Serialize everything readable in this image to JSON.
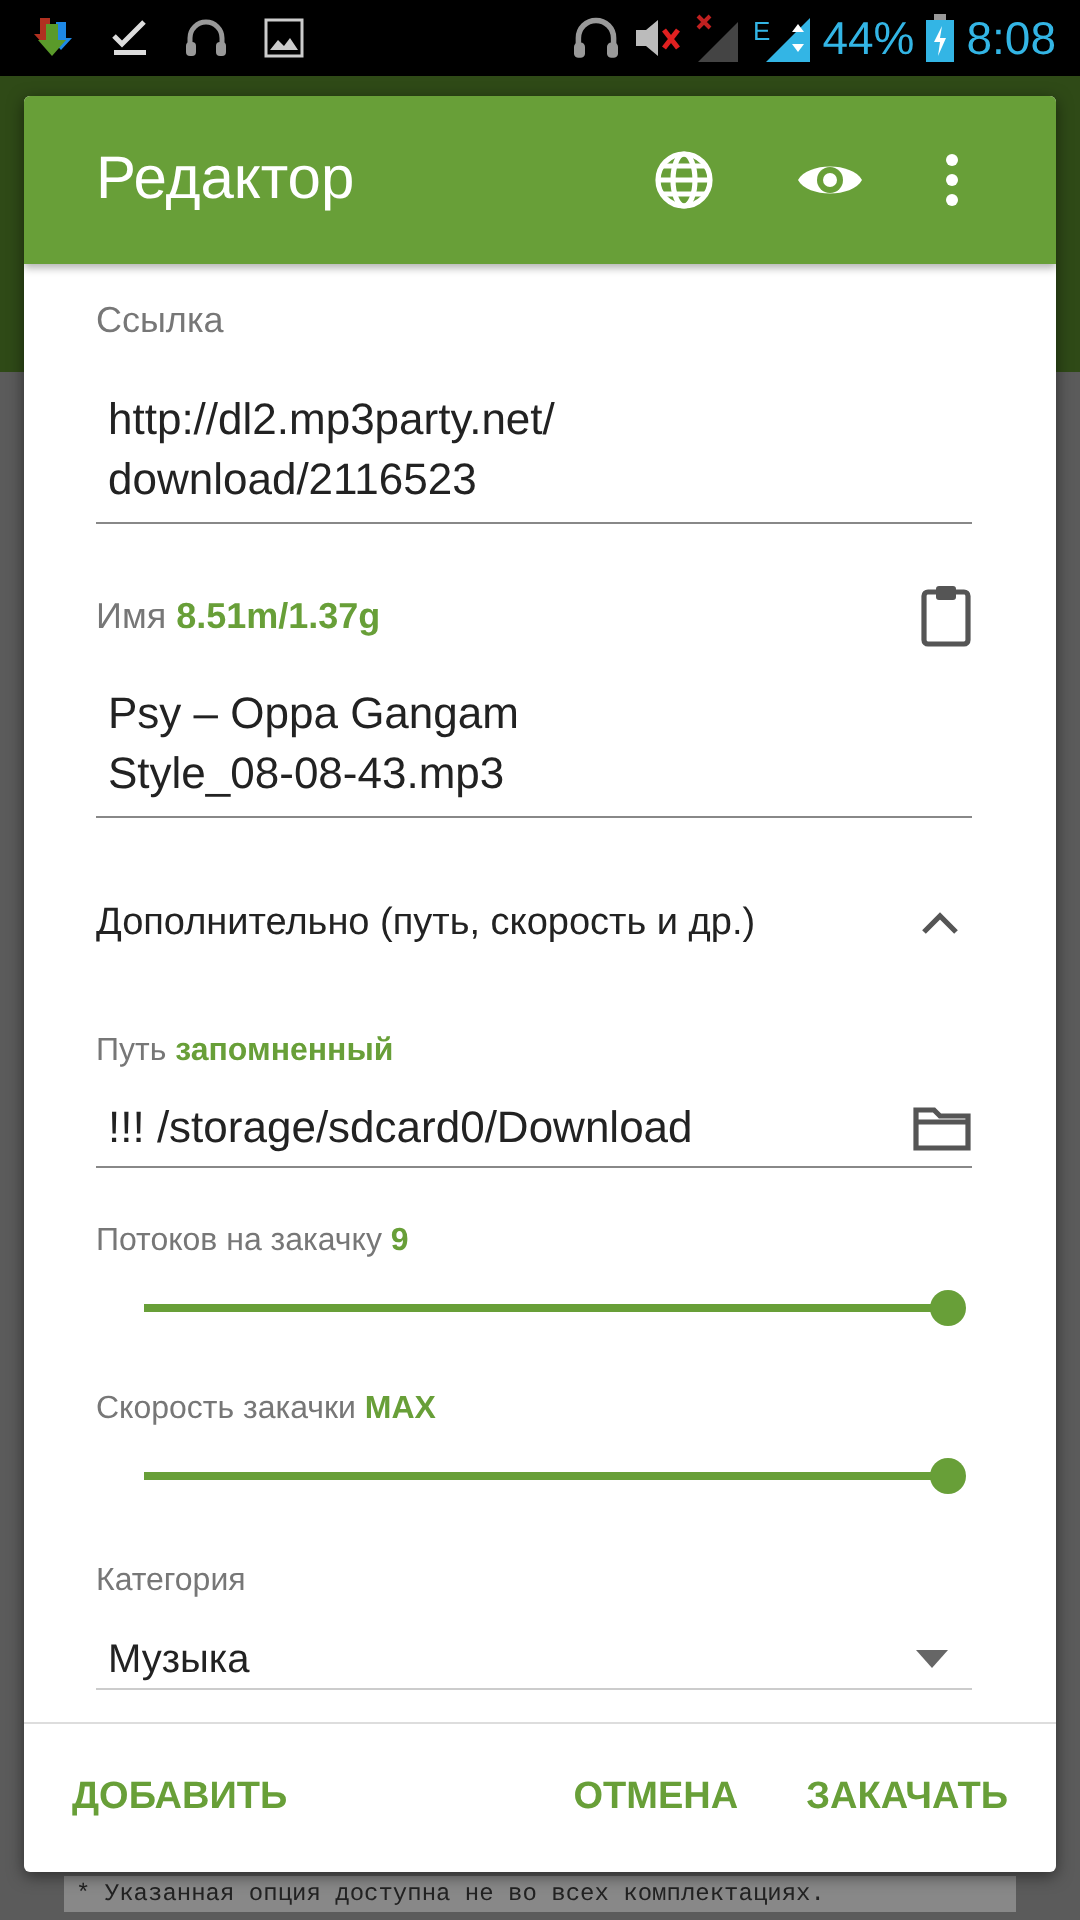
{
  "status_bar": {
    "network": "E",
    "battery": "44%",
    "time": "8:08"
  },
  "dialog": {
    "title": "Редактор",
    "link": {
      "label": "Ссылка",
      "value": "http://dl2.mp3party.net/\ndownload/2116523"
    },
    "name": {
      "label": "Имя",
      "size": "8.51m/1.37g",
      "value": "Psy – Oppa Gangam\nStyle_08-08-43.mp3"
    },
    "advanced": {
      "label": "Дополнительно (путь, скорость и др.)",
      "expanded": true
    },
    "path": {
      "label": "Путь",
      "note": "запомненный",
      "value": "!!! /storage/sdcard0/Download"
    },
    "threads": {
      "label": "Потоков на закачку",
      "value": "9",
      "level": 1.0
    },
    "speed": {
      "label": "Скорость закачки",
      "value": "MAX",
      "level": 1.0
    },
    "category": {
      "label": "Категория",
      "value": "Музыка"
    },
    "buttons": [
      {
        "label": "ДОБАВИТЬ",
        "kind": "left"
      },
      {
        "label": "ОТМЕНА",
        "kind": "right"
      },
      {
        "label": "ЗАКАЧАТЬ",
        "kind": "right"
      }
    ]
  },
  "background_note": "* Указанная опция доступна не во всех комплектациях."
}
